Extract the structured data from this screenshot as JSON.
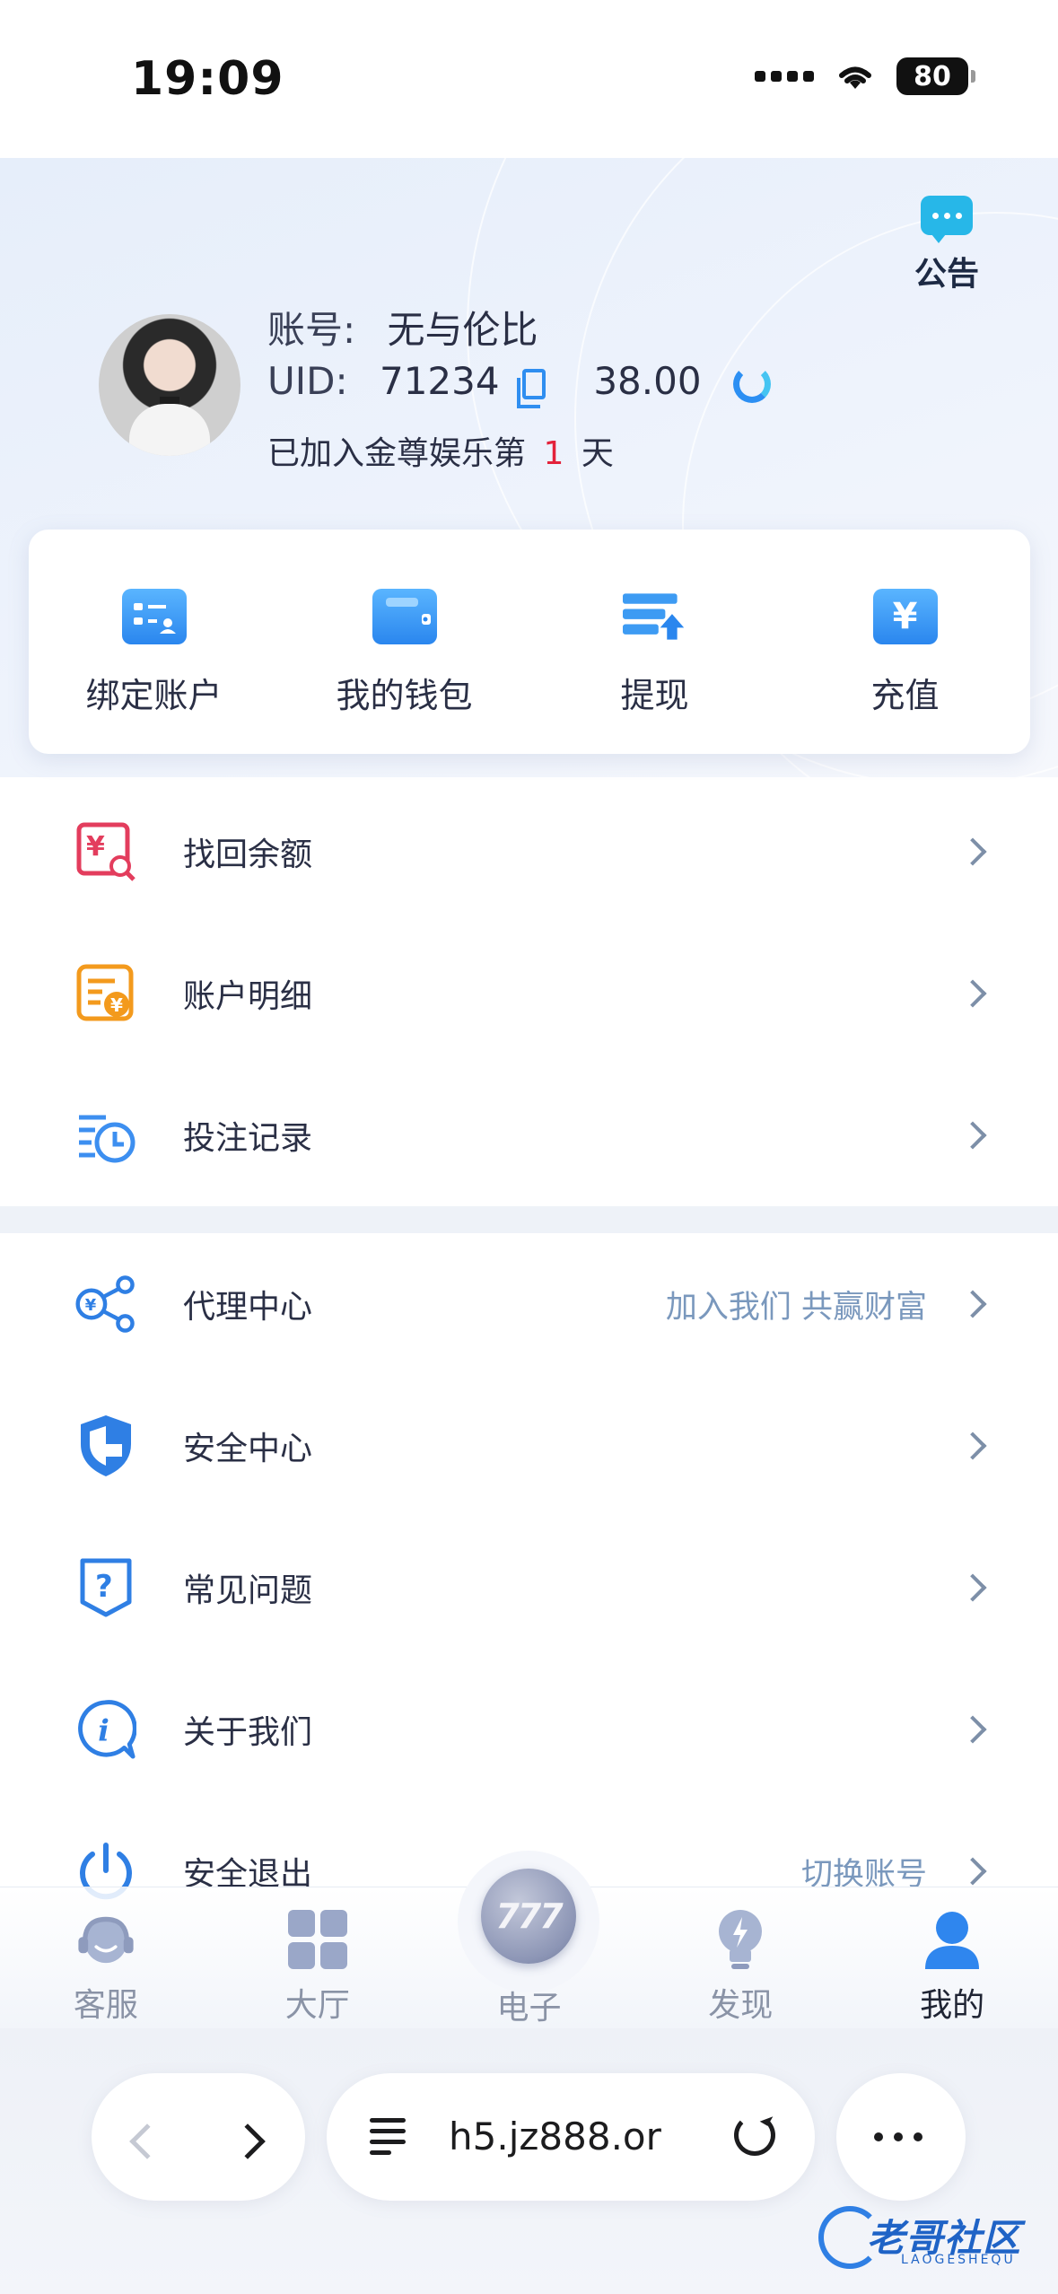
{
  "status_bar": {
    "time": "19:09",
    "battery": "80"
  },
  "header": {
    "notice_label": "公告",
    "account_label": "账号:",
    "account_name": "无与伦比",
    "uid_label": "UID:",
    "uid_value": "71234",
    "balance": "38.00",
    "days_prefix": "已加入金尊娱乐第",
    "days_count": "1",
    "days_suffix": "天"
  },
  "quick_actions": [
    {
      "label": "绑定账户",
      "icon": "bind-account-icon"
    },
    {
      "label": "我的钱包",
      "icon": "wallet-icon"
    },
    {
      "label": "提现",
      "icon": "withdraw-icon"
    },
    {
      "label": "充值",
      "icon": "recharge-icon",
      "glyph": "¥"
    }
  ],
  "menu_group_1": [
    {
      "label": "找回余额",
      "icon": "recover-balance-icon"
    },
    {
      "label": "账户明细",
      "icon": "account-details-icon"
    },
    {
      "label": "投注记录",
      "icon": "bet-records-icon"
    }
  ],
  "menu_group_2": [
    {
      "label": "代理中心",
      "icon": "agent-center-icon",
      "extra": "加入我们 共赢财富"
    },
    {
      "label": "安全中心",
      "icon": "shield-icon",
      "extra": ""
    },
    {
      "label": "常见问题",
      "icon": "faq-icon",
      "extra": ""
    },
    {
      "label": "关于我们",
      "icon": "info-icon",
      "extra": ""
    },
    {
      "label": "安全退出",
      "icon": "power-icon",
      "extra": "切换账号"
    }
  ],
  "tab_bar": [
    {
      "label": "客服",
      "icon": "customer-service-icon"
    },
    {
      "label": "大厅",
      "icon": "lobby-grid-icon"
    },
    {
      "label": "电子",
      "icon": "slots-777-icon",
      "glyph": "777"
    },
    {
      "label": "发现",
      "icon": "discover-bulb-icon"
    },
    {
      "label": "我的",
      "icon": "profile-icon",
      "active": true
    }
  ],
  "browser": {
    "url": "h5.jz888.or"
  },
  "watermark": {
    "text": "老哥社区",
    "sub": "LAOGESHEQU"
  },
  "colors": {
    "accent": "#2f8ef0",
    "highlight_red": "#e3223b",
    "extra_text": "#7a98bd"
  }
}
